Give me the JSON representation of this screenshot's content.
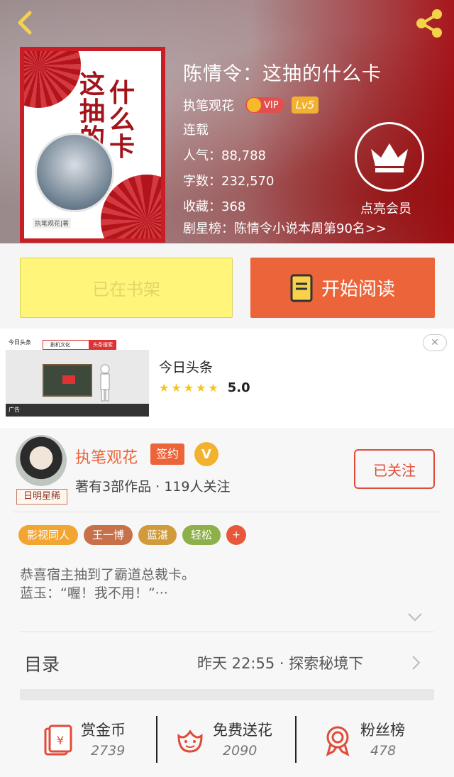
{
  "header": {
    "title": "陈情令：这抽的什么卡",
    "author": "执笔观花",
    "vip_label": "VIP",
    "level": "Lv5",
    "status": "连载",
    "popularity": "人气：88,788",
    "word_count": "字数：232,570",
    "collections": "收藏：368",
    "rank": "剧星榜：陈情令小说本周第90名>>",
    "vip_member_label": "点亮会员"
  },
  "cover": {
    "title_col1": "这抽的",
    "title_col2": "什么卡",
    "author_stamp": "执笔观花|著"
  },
  "buttons": {
    "shelf": "已在书架",
    "read": "开始阅读"
  },
  "ad": {
    "title": "今日头条",
    "rating": "5.0",
    "stars": 5,
    "close": "✕",
    "img_logo": "今日头条",
    "img_search": "剧机文化",
    "img_search_btn": "头条搜索",
    "img_bottom": "广告"
  },
  "author_card": {
    "name": "执笔观花",
    "sign_tag": "签约",
    "v_badge": "V",
    "avatar_badge": "日明星稀",
    "subtitle": "著有3部作品 · 119人关注",
    "follow": "已关注",
    "tags": [
      {
        "label": "影视同人",
        "color": "#f2a531"
      },
      {
        "label": "王一博",
        "color": "#c8704a"
      },
      {
        "label": "蓝湛",
        "color": "#d19a3a"
      },
      {
        "label": "轻松",
        "color": "#8db04a"
      },
      {
        "label": "+",
        "color": "#e9573a"
      }
    ],
    "description": "恭喜宿主抽到了霸道总裁卡。\n蓝玉：“喔！我不用！”···"
  },
  "toc": {
    "label": "目录",
    "info": "昨天 22:55 · 探索秘境下"
  },
  "actions": [
    {
      "label": "赏金币",
      "count": "2739",
      "icon": "red-envelope-icon"
    },
    {
      "label": "免费送花",
      "count": "2090",
      "icon": "flower-icon"
    },
    {
      "label": "粉丝榜",
      "count": "478",
      "icon": "ribbon-medal-icon"
    }
  ],
  "colors": {
    "accent": "#ec6439",
    "shelf_yellow": "#fff57a",
    "header_red": "#a6171c"
  }
}
